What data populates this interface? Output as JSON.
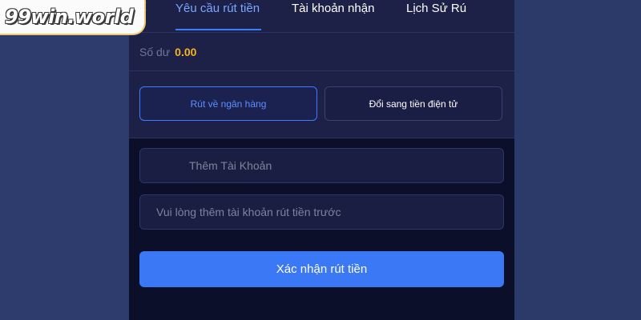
{
  "logo": {
    "text": "99win.world"
  },
  "tabs": [
    {
      "label": "Yêu cầu rút tiền",
      "active": true
    },
    {
      "label": "Tài khoản nhận",
      "active": false
    },
    {
      "label": "Lịch Sử Rú",
      "active": false
    }
  ],
  "balance": {
    "label": "Số dư",
    "value": "0.00"
  },
  "methods": [
    {
      "label": "Rút về ngân hàng",
      "selected": true
    },
    {
      "label": "Đổi sang tiền điện tử",
      "selected": false
    }
  ],
  "fields": {
    "add_account": "Thêm Tài Khoản",
    "account_placeholder": "Vui lòng thêm tài khoản rút tiền trước"
  },
  "submit": {
    "label": "Xác nhận rút tiền"
  },
  "colors": {
    "accent": "#3a78f5",
    "balance": "#f6b31b",
    "panel": "#1d2148",
    "background": "#2b3a6b"
  },
  "icons": {
    "back": "chevron-left-icon"
  }
}
